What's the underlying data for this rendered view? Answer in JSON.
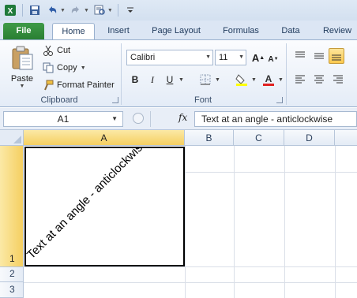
{
  "qat": {
    "excel_icon": "excel-logo-icon",
    "save_icon": "save-icon",
    "undo_icon": "undo-icon",
    "redo_icon": "redo-icon"
  },
  "tabs": [
    "File",
    "Home",
    "Insert",
    "Page Layout",
    "Formulas",
    "Data",
    "Review"
  ],
  "clipboard": {
    "paste": "Paste",
    "cut": "Cut",
    "copy": "Copy",
    "format_painter": "Format Painter",
    "label": "Clipboard"
  },
  "font": {
    "name": "Calibri",
    "size": "11",
    "bold": "B",
    "italic": "I",
    "underline": "U",
    "grow": "A",
    "shrink": "A",
    "label": "Font"
  },
  "formula_bar": {
    "cell_ref": "A1",
    "fx": "fx",
    "value": "Text at an angle - anticlockwise"
  },
  "sheet": {
    "columns": [
      "A",
      "B",
      "C",
      "D"
    ],
    "rows": [
      "1",
      "2",
      "3"
    ],
    "cell_a1": "Text at an angle - anticlockwise"
  },
  "colors": {
    "file_tab": "#2a7f33",
    "active_header": "#f5cf61",
    "ribbon_border": "#9ab1cf"
  }
}
